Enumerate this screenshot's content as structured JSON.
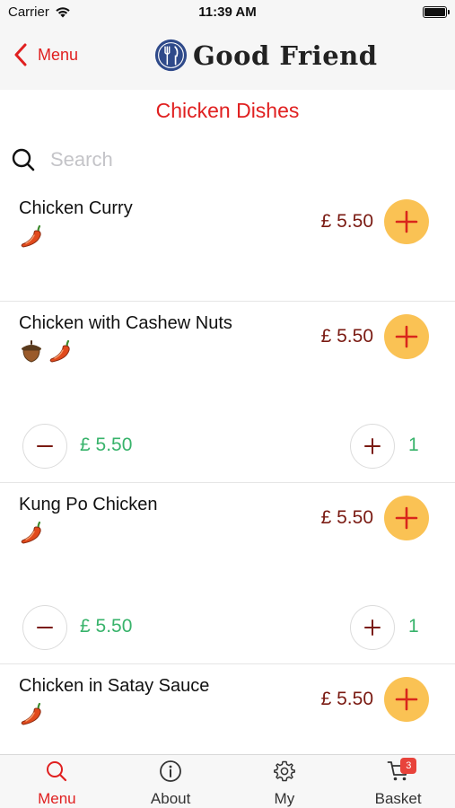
{
  "status_bar": {
    "carrier": "Carrier",
    "time": "11:39 AM",
    "battery_level": 1.0
  },
  "nav": {
    "back_label": "Menu",
    "brand_name": "Good Friend",
    "back_icon": "chevron-left-icon",
    "logo_icon": "fork-knife-logo"
  },
  "category": {
    "title": "Chicken Dishes"
  },
  "search": {
    "placeholder": "Search",
    "value": "",
    "icon": "search-icon"
  },
  "colors": {
    "accent": "#e02020",
    "price": "#7a1a12",
    "add_button": "#fac254",
    "qty_text": "#38b36b",
    "badge": "#e8433b"
  },
  "dishes": [
    {
      "name": "Chicken Curry",
      "price": "£ 5.50",
      "icons": [
        "chili-icon"
      ],
      "in_basket": false
    },
    {
      "name": "Chicken with Cashew Nuts",
      "price": "£ 5.50",
      "icons": [
        "nut-icon",
        "chili-icon"
      ],
      "in_basket": true,
      "basket_price": "£ 5.50",
      "quantity": "1"
    },
    {
      "name": "Kung Po Chicken",
      "price": "£ 5.50",
      "icons": [
        "chili-icon"
      ],
      "in_basket": true,
      "basket_price": "£ 5.50",
      "quantity": "1"
    },
    {
      "name": "Chicken in Satay Sauce",
      "price": "£ 5.50",
      "icons": [
        "chili-icon"
      ],
      "in_basket": false
    }
  ],
  "tabs": [
    {
      "label": "Menu",
      "icon": "search-icon",
      "active": true
    },
    {
      "label": "About",
      "icon": "info-icon",
      "active": false
    },
    {
      "label": "My",
      "icon": "gear-icon",
      "active": false
    },
    {
      "label": "Basket",
      "icon": "cart-icon",
      "active": false,
      "badge": "3"
    }
  ]
}
